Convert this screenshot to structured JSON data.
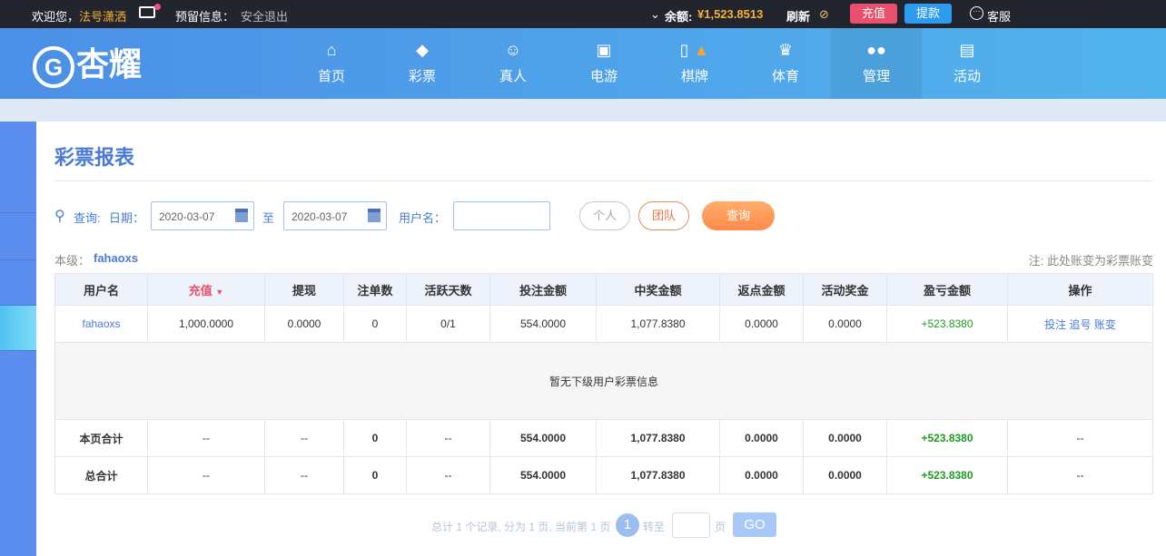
{
  "topbar": {
    "welcome": "欢迎您，",
    "username": "法号潇洒",
    "mail_icon": "envelope-icon",
    "reserved_info": "预留信息：",
    "logout": "安全退出",
    "balance_label": "余额:",
    "balance": "¥1,523.8513",
    "refresh": "刷新",
    "deposit": "充值",
    "withdraw": "提款",
    "service": "客服"
  },
  "logo": {
    "text": "杏耀",
    "mark": "G"
  },
  "nav": [
    {
      "label": "首页",
      "icon": "home-icon"
    },
    {
      "label": "彩票",
      "icon": "ticket-icon"
    },
    {
      "label": "真人",
      "icon": "dealer-icon"
    },
    {
      "label": "电游",
      "icon": "slot-icon"
    },
    {
      "label": "棋牌",
      "icon": "mahjong-icon"
    },
    {
      "label": "体育",
      "icon": "trophy-icon"
    },
    {
      "label": "管理",
      "icon": "users-icon"
    },
    {
      "label": "活动",
      "icon": "gift-icon"
    }
  ],
  "page": {
    "title": "彩票报表",
    "query_label": "查询:",
    "date_label": "日期：",
    "date_from": "2020-03-07",
    "to": "至",
    "date_to": "2020-03-07",
    "username_label": "用户名：",
    "username_value": "",
    "personal": "个人",
    "team": "团队",
    "search": "查询",
    "level_label": "本级：",
    "level_user": "fahaoxs",
    "note": "注: 此处账变为彩票账变"
  },
  "table": {
    "headers": [
      "用户名",
      "充值",
      "提现",
      "注单数",
      "活跃天数",
      "投注金额",
      "中奖金额",
      "返点金额",
      "活动奖金",
      "盈亏金额",
      "操作"
    ],
    "row": [
      "fahaoxs",
      "1,000.0000",
      "0.0000",
      "0",
      "0/1",
      "554.0000",
      "1,077.8380",
      "0.0000",
      "0.0000",
      "+523.8380"
    ],
    "actions": [
      "投注",
      "追号",
      "账变"
    ],
    "empty": "暂无下级用户彩票信息",
    "subtotal": [
      "本页合计",
      "--",
      "--",
      "0",
      "--",
      "554.0000",
      "1,077.8380",
      "0.0000",
      "0.0000",
      "+523.8380",
      "--"
    ],
    "total": [
      "总合计",
      "--",
      "--",
      "0",
      "--",
      "554.0000",
      "1,077.8380",
      "0.0000",
      "0.0000",
      "+523.8380",
      "--"
    ]
  },
  "pagination": {
    "summary": "总计 1 个记录, 分为 1 页, 当前第 1 页",
    "current": "1",
    "goto": "转至",
    "page_unit": "页",
    "go": "GO"
  },
  "colors": {
    "accent": "#4a7ad9",
    "gain": "#1f9a1f",
    "deposit": "#e8506e",
    "withdraw": "#2d9cf0"
  }
}
